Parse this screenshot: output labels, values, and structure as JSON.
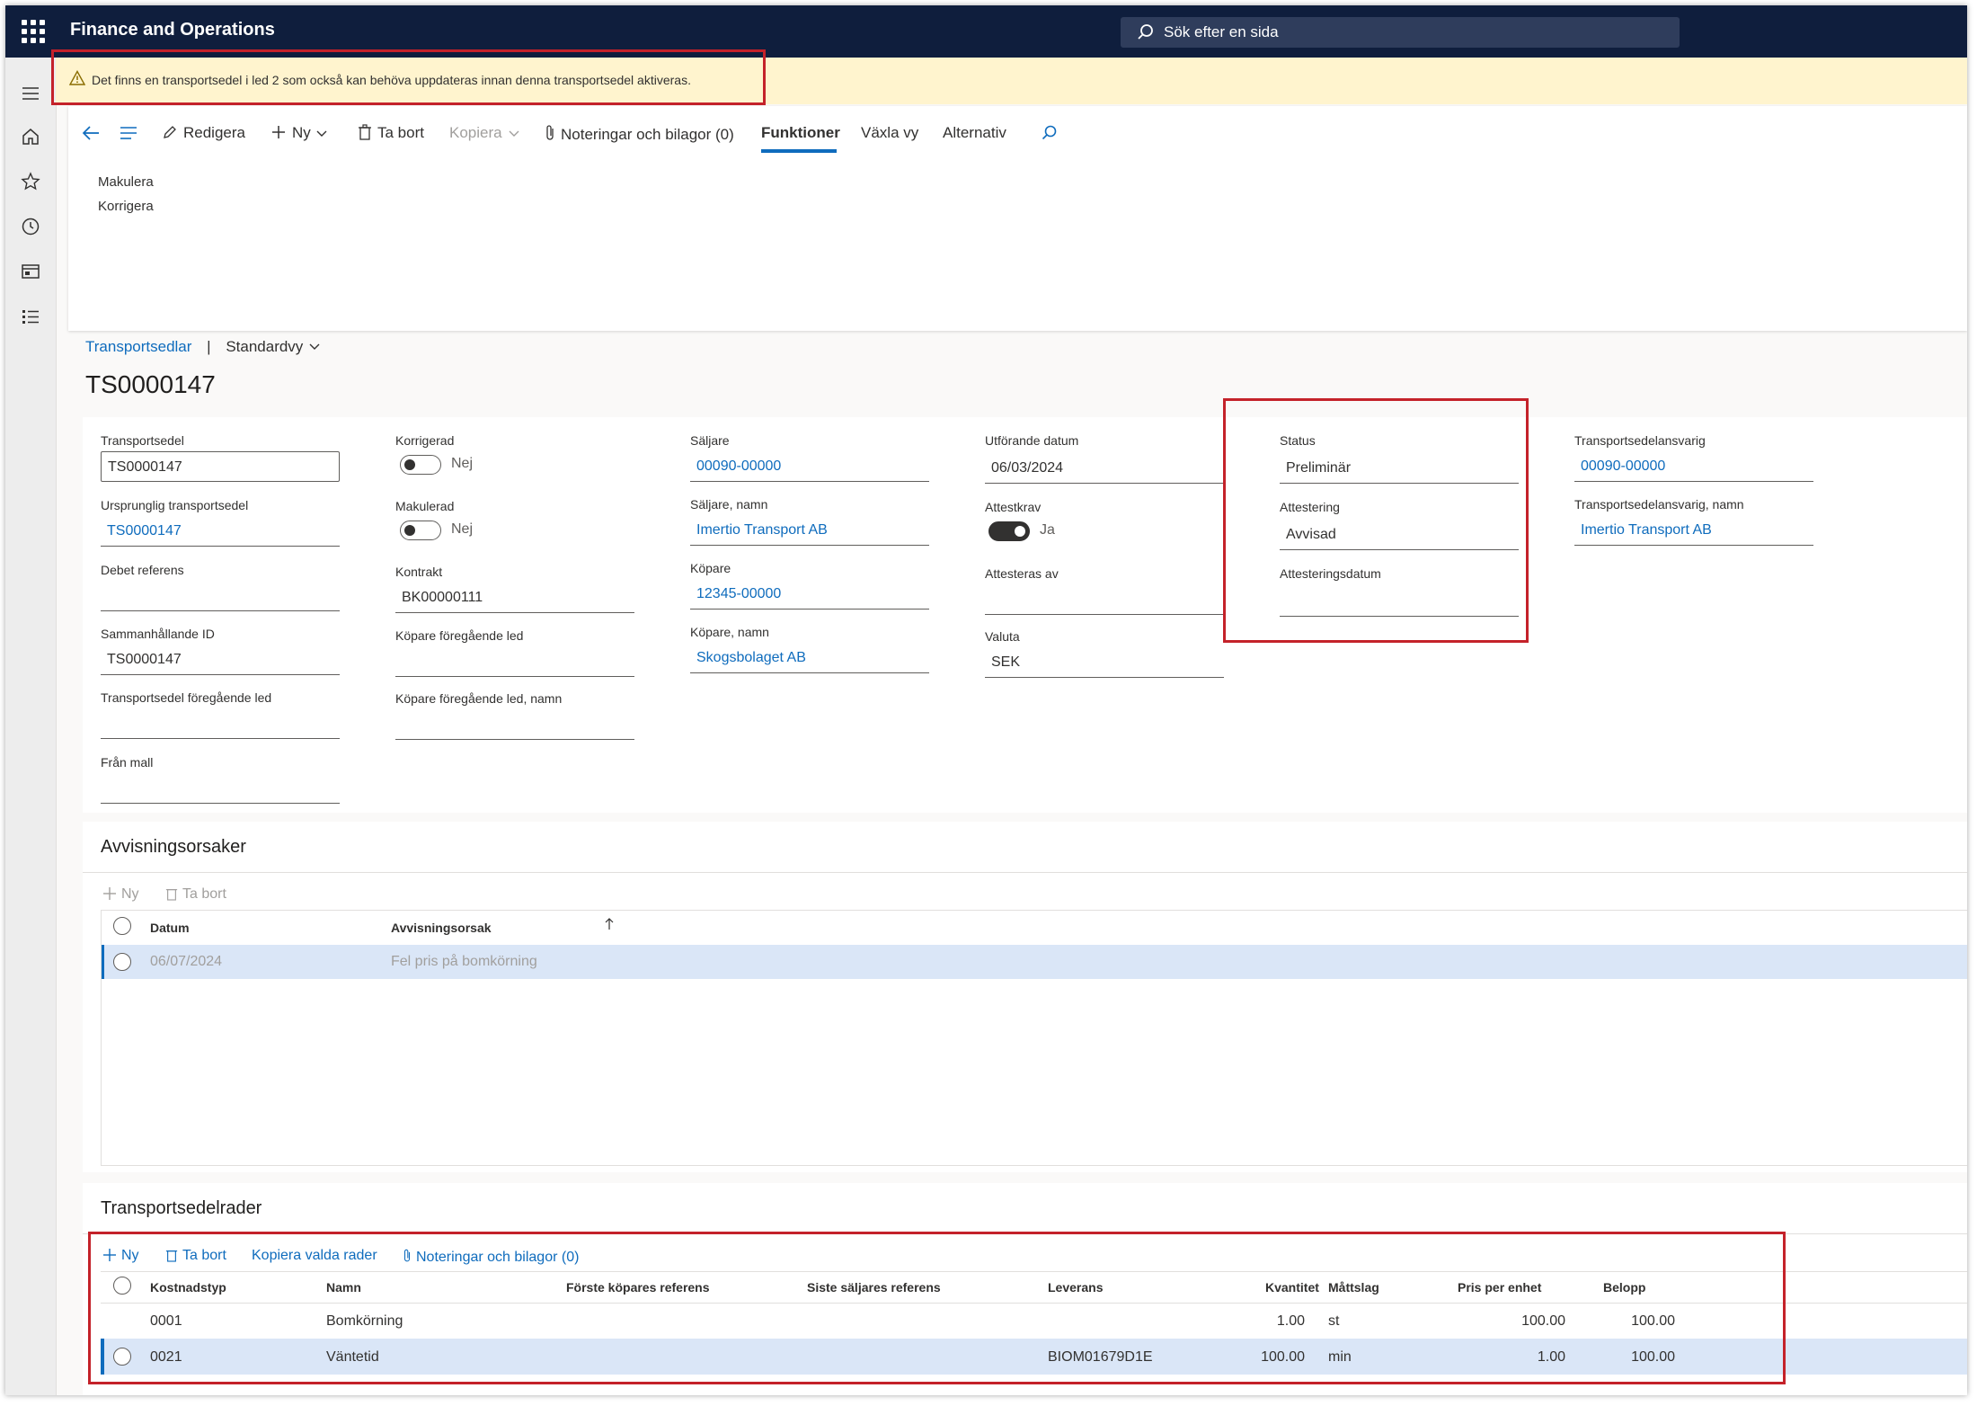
{
  "app": {
    "title": "Finance and Operations",
    "search_placeholder": "Sök efter en sida"
  },
  "warning": {
    "text": "Det finns en transportsedel i led 2 som också kan behöva uppdateras innan denna transportsedel aktiveras."
  },
  "toolbar": {
    "edit": "Redigera",
    "new": "Ny",
    "delete": "Ta bort",
    "copy": "Kopiera",
    "notes": "Noteringar och bilagor (0)",
    "functions": "Funktioner",
    "switch_view": "Växla vy",
    "options": "Alternativ"
  },
  "functions_menu": {
    "items": [
      "Makulera",
      "Korrigera"
    ]
  },
  "breadcrumb": {
    "link": "Transportsedlar",
    "separator": "|",
    "view": "Standardvy"
  },
  "page_title": "TS0000147",
  "header": {
    "col1": {
      "transportsedel_label": "Transportsedel",
      "transportsedel_value": "TS0000147",
      "ursprunglig_label": "Ursprunglig transportsedel",
      "ursprunglig_value": "TS0000147",
      "debet_label": "Debet referens",
      "debet_value": "",
      "samman_label": "Sammanhållande ID",
      "samman_value": "TS0000147",
      "foreg_label": "Transportsedel föregående led",
      "foreg_value": "",
      "mall_label": "Från mall",
      "mall_value": ""
    },
    "col2": {
      "korrigerad_label": "Korrigerad",
      "korrigerad_value": "Nej",
      "makulerad_label": "Makulerad",
      "makulerad_value": "Nej",
      "kontrakt_label": "Kontrakt",
      "kontrakt_value": "BK00000111",
      "kopare_foreg_label": "Köpare föregående led",
      "kopare_foreg_value": "",
      "kopare_foreg_namn_label": "Köpare föregående led, namn",
      "kopare_foreg_namn_value": ""
    },
    "col3": {
      "saljare_label": "Säljare",
      "saljare_value": "00090-00000",
      "saljare_namn_label": "Säljare, namn",
      "saljare_namn_value": "Imertio Transport AB",
      "kopare_label": "Köpare",
      "kopare_value": "12345-00000",
      "kopare_namn_label": "Köpare, namn",
      "kopare_namn_value": "Skogsbolaget AB"
    },
    "col4": {
      "datum_label": "Utförande datum",
      "datum_value": "06/03/2024",
      "attestkrav_label": "Attestkrav",
      "attestkrav_value": "Ja",
      "attesteras_label": "Attesteras av",
      "attesteras_value": "",
      "valuta_label": "Valuta",
      "valuta_value": "SEK"
    },
    "col5": {
      "status_label": "Status",
      "status_value": "Preliminär",
      "attestering_label": "Attestering",
      "attestering_value": "Avvisad",
      "attdatum_label": "Attesteringsdatum",
      "attdatum_value": ""
    },
    "col6": {
      "ansvarig_label": "Transportsedelansvarig",
      "ansvarig_value": "00090-00000",
      "ansvarig_namn_label": "Transportsedelansvarig, namn",
      "ansvarig_namn_value": "Imertio Transport AB"
    }
  },
  "rejections": {
    "title": "Avvisningsorsaker",
    "new": "Ny",
    "delete": "Ta bort",
    "columns": [
      "Datum",
      "Avvisningsorsak"
    ],
    "rows": [
      {
        "datum": "06/07/2024",
        "orsak": "Fel pris på bomkörning"
      }
    ]
  },
  "lines": {
    "title": "Transportsedelrader",
    "new": "Ny",
    "delete": "Ta bort",
    "copy_selected": "Kopiera valda rader",
    "notes": "Noteringar och bilagor (0)",
    "columns": [
      "Kostnadstyp",
      "Namn",
      "Förste köpares referens",
      "Siste säljares referens",
      "Leverans",
      "Kvantitet",
      "Måttslag",
      "Pris per enhet",
      "Belopp"
    ],
    "rows": [
      {
        "kostnadstyp": "0001",
        "namn": "Bomkörning",
        "forste": "",
        "siste": "",
        "leverans": "",
        "kvantitet": "1.00",
        "mattslag": "st",
        "pris": "100.00",
        "belopp": "100.00"
      },
      {
        "kostnadstyp": "0021",
        "namn": "Väntetid",
        "forste": "",
        "siste": "",
        "leverans": "BIOM01679D1E",
        "kvantitet": "100.00",
        "mattslag": "min",
        "pris": "1.00",
        "belopp": "100.00"
      }
    ]
  },
  "colors": {
    "topbar": "#0f1e3d",
    "accent": "#0f6cbd",
    "warning_bg": "#fff4ce",
    "highlight_box": "#c4222a",
    "selected_row": "#dae6f7"
  }
}
